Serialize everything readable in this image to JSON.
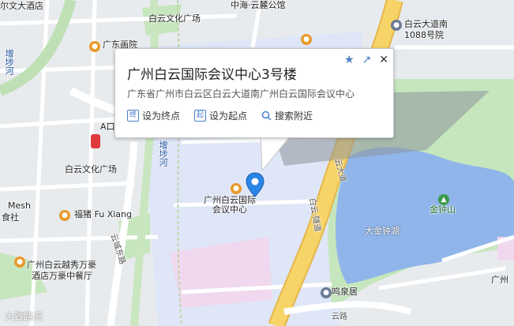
{
  "popup": {
    "title": "广州白云国际会议中心3号楼",
    "address": "广东省广州市白云区白云大道南广州白云国际会议中心",
    "actions": [
      {
        "badge": "终",
        "label": "设为终点"
      },
      {
        "badge": "起",
        "label": "设为起点"
      },
      {
        "label": "搜索附近"
      }
    ],
    "star_icon": "★",
    "share_icon": "↗",
    "close_icon": "✕"
  },
  "marker": {
    "label": "广州白云国际\n会议中心"
  },
  "labels": {
    "top_left_1": "尔文大酒店",
    "top_middle": "白云文化广场",
    "top_poi": "中海·云麓公馆",
    "top_right_1": "白云大道南",
    "top_right_2": "1088号院",
    "cinema": "广东画院",
    "white_cloud_culture": "白云文化广场",
    "river": "增埗河",
    "river2": "增埗河",
    "a_area": "A口",
    "mesh": "Mesh",
    "hotel_food": "食社",
    "fuxiang": "福猪 Fu Xiang",
    "wanda": "广州白云越秀万豪",
    "wanda2": "酒店万豪中餐厅",
    "road_east": "云城东路",
    "tunnel": "白云·隧道",
    "tunnel_top": "云大道",
    "lake": "大金钟湖",
    "hill": "金钟山",
    "spring": "鸣泉居",
    "bottom_road": "云路",
    "bottom_right": "广州",
    "gz_bottom": "广州"
  },
  "watermark": "大致路况",
  "colors": {
    "road_major": "#f7d468",
    "water": "#8fb5ea",
    "green": "#bfe3b8",
    "highlight": "#d3e3fb",
    "pink": "#f0d8ee"
  }
}
